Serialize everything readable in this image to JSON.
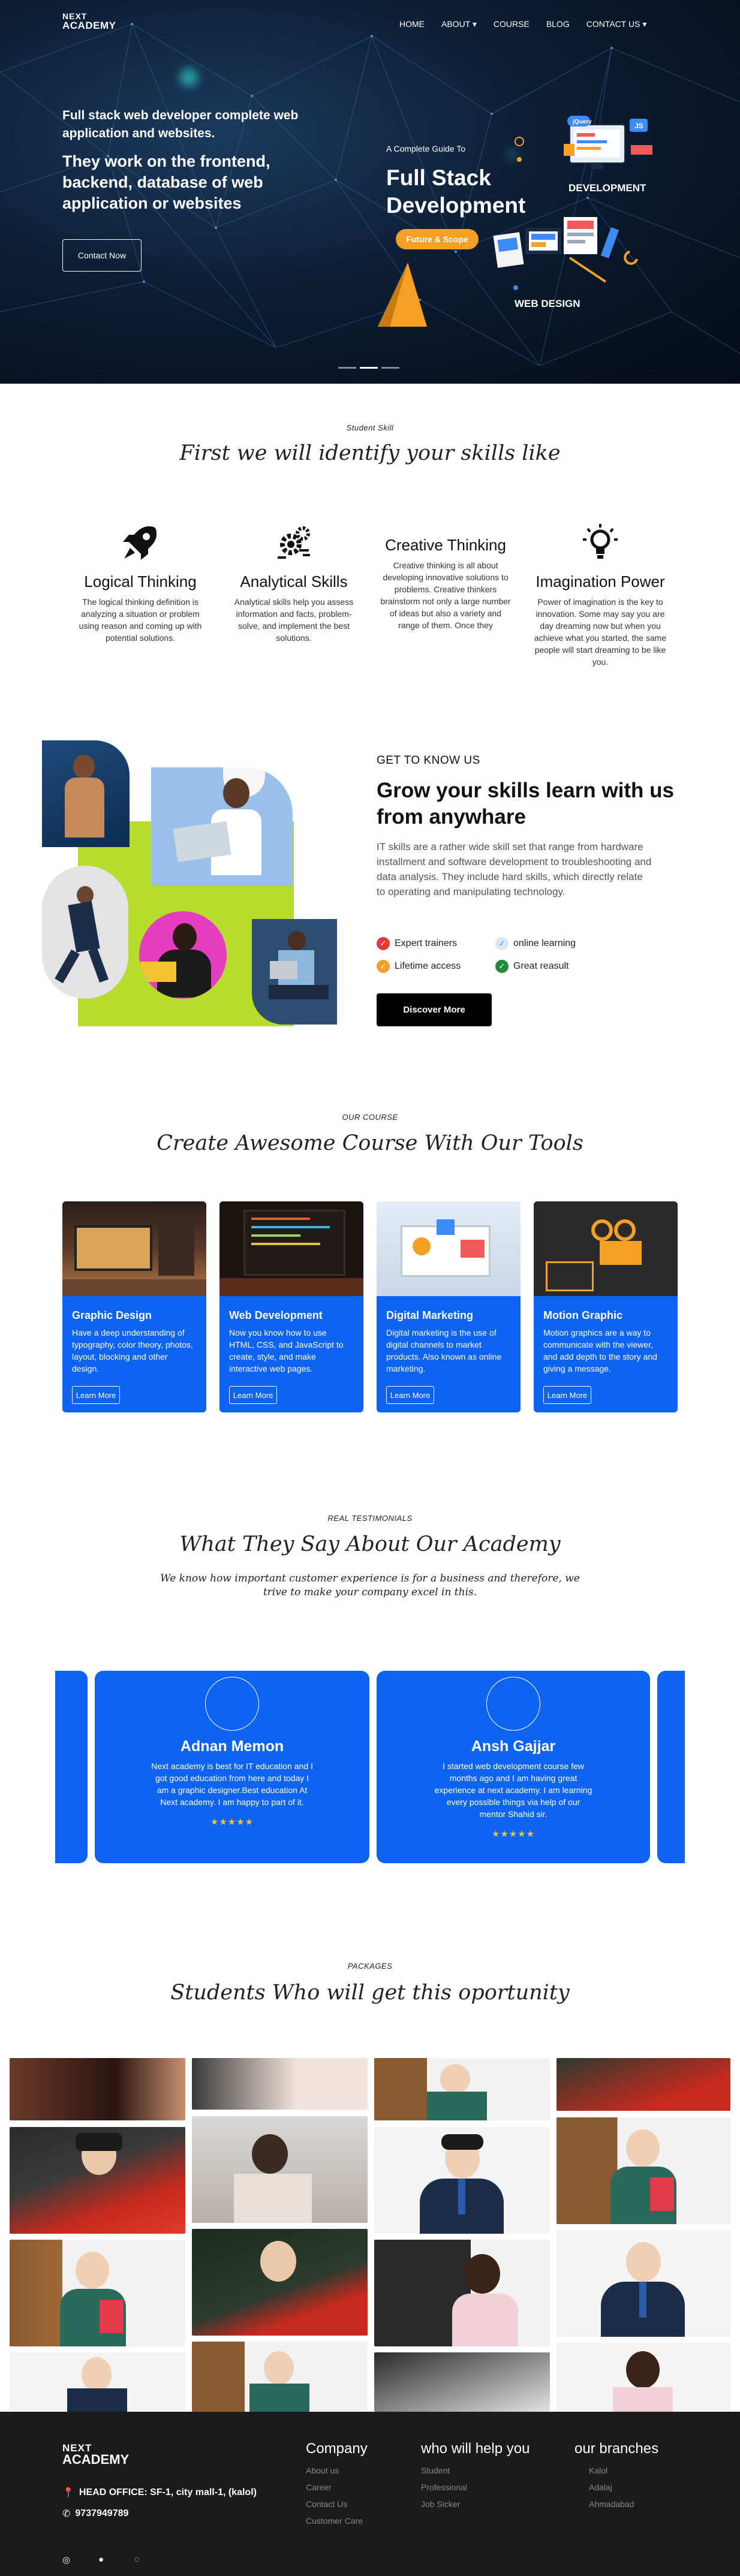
{
  "brand": {
    "logo_line1": "NEXT",
    "logo_line2": "ACADEMY"
  },
  "nav": [
    {
      "label": "HOME"
    },
    {
      "label": "ABOUT ▾"
    },
    {
      "label": "COURSE"
    },
    {
      "label": "BLOG"
    },
    {
      "label": "CONTACT US ▾"
    }
  ],
  "hero": {
    "line1": "Full stack web developer complete web application and websites.",
    "line2": "They work on the frontend, backend, database of web application or websites",
    "cta": "Contact Now",
    "guide_small": "A Complete Guide To",
    "guide_title_1": "Full Stack",
    "guide_title_2": "Development",
    "badge": "Future & Scope",
    "label_dev": "DEVELOPMENT",
    "label_web": "WEB DESIGN"
  },
  "skills": {
    "kicker": "Student Skill",
    "title": "First we will identify your skills like",
    "items": [
      {
        "title": "Logical Thinking",
        "text": "The logical thinking definition is analyzing a situation or problem using reason and coming up with potential solutions.",
        "icon": "rocket-icon"
      },
      {
        "title": "Analytical Skills",
        "text": "Analytical skills help you assess information and facts, problem-solve, and implement the best solutions.",
        "icon": "gears-icon"
      },
      {
        "title": "Creative Thinking",
        "text": "Creative thinking is all about developing innovative solutions to problems. Creative thinkers brainstorm not only a large number of ideas but also a variety and range of them. Once they",
        "icon": ""
      },
      {
        "title": "Imagination Power",
        "text": "Power of imagination is the key to innovation. Some may say you are day dreaming now but when you achieve what you started, the same people will start dreaming to be like you.",
        "icon": "bulb-icon"
      }
    ]
  },
  "grow": {
    "kicker": "GET TO KNOW US",
    "title": "Grow your skills learn with us from anywhare",
    "text": "IT skills are a rather wide skill set that range from hardware installment and software development to troubleshooting and data analysis. They include hard skills, which directly relate to operating and manipulating technology.",
    "features": [
      "Expert trainers",
      "online learning",
      "Lifetime access",
      "Great reasult"
    ],
    "feature_colors": [
      "#e23a3a",
      "#3b8df5",
      "#f4a024",
      "#1f8b3b"
    ],
    "cta": "Discover More"
  },
  "courses": {
    "kicker": "OUR COURSE",
    "title": "Create Awesome Course With Our Tools",
    "items": [
      {
        "title": "Graphic Design",
        "text": "Have a deep understanding of typography, color theory, photos, layout, blocking and other design.",
        "btn": "Learn More"
      },
      {
        "title": "Web Development",
        "text": "Now you know how to use HTML, CSS, and JavaScript to create, style, and make interactive web pages.",
        "btn": "Learn More"
      },
      {
        "title": "Digital Marketing",
        "text": "Digital marketing is the use of digital channels to market products. Also known as online marketing.",
        "btn": "Learn More"
      },
      {
        "title": "Motion Graphic",
        "text": "Motion graphics are a way to communicate with the viewer, and add depth to the story and giving a message.",
        "btn": "Learn More"
      }
    ]
  },
  "testimonials": {
    "kicker": "REAL TESTIMONIALS",
    "title": "What They Say About Our Academy",
    "subtitle": "We know how important customer experience is for a business and therefore, we trive to make your company excel in this.",
    "items": [
      {
        "name": "Adnan Memon",
        "text": "Next academy is best for IT education and I got good education from here and today I am a graphic designer.Best education At Next academy. I am happy to part of it.",
        "stars": "★★★★★"
      },
      {
        "name": "Ansh Gajjar",
        "text": "I started web development course few months ago and I am having great experience at next academy. I am learning every possible things via help of our mentor Shahid sir.",
        "stars": "★★★★★"
      }
    ]
  },
  "packages": {
    "kicker": "PACKAGES",
    "title": "Students Who will get this oportunity"
  },
  "footer": {
    "address": "HEAD OFFICE: SF-1, city mall-1, (kalol)",
    "phone": "9737949789",
    "cols": [
      {
        "title": "Company",
        "links": [
          "About us",
          "Career",
          "Contact Us",
          "Customer Care"
        ]
      },
      {
        "title": "who will help you",
        "links": [
          "Student",
          "Professional",
          "Job Sicker"
        ]
      },
      {
        "title": "our branches",
        "links": [
          "Kalol",
          "Adalaj",
          "Ahmadabad"
        ]
      }
    ]
  }
}
